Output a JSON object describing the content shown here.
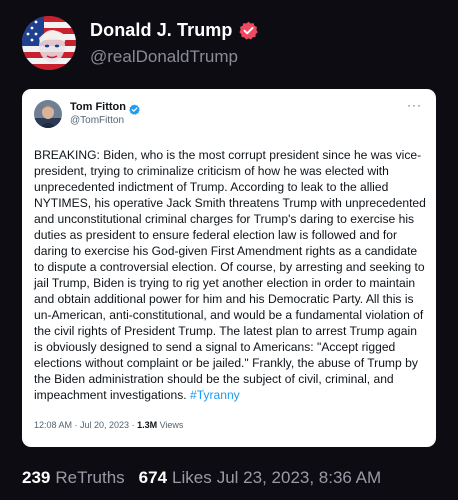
{
  "post": {
    "author_name": "Donald J. Trump",
    "author_handle": "@realDonaldTrump",
    "verified_badge_icon": "verified-check-icon",
    "verified_color": "#ee4b63"
  },
  "embedded_tweet": {
    "author_name": "Tom Fitton",
    "author_handle": "@TomFitton",
    "more_icon": "more-options-icon",
    "verified_color": "#1d9bf0",
    "body": "BREAKING: Biden, who is the most corrupt president since he was vice-president, trying to criminalize criticism of how he was elected with unprecedented indictment of Trump. According to leak to the allied NYTIMES, his operative Jack Smith threatens Trump with unprecedented and unconstitutional criminal charges for Trump's daring to exercise his duties as president to ensure federal election law is followed and  for daring to exercise his God-given First Amendment rights as a candidate to dispute a controversial election.  Of course, by arresting and seeking to jail Trump, Biden is trying to rig yet another election in order to maintain and obtain additional power for him and his Democratic Party. All this is un-American, anti-constitutional, and would be a fundamental violation of the civil rights of President Trump. The latest plan to arrest Trump again is obviously designed to send a signal to Americans: \"Accept rigged elections without complaint or be jailed.\" Frankly, the abuse of Trump by the Biden administration should be the subject of civil, criminal, and impeachment investigations.",
    "hashtag": "#Tyranny",
    "timestamp": "12:08 AM · Jul 20, 2023 · ",
    "views_count": "1.3M",
    "views_label": " Views"
  },
  "stats": {
    "retruths_count": "239",
    "retruths_label": "ReTruths",
    "likes_count": "674",
    "likes_label": "Likes",
    "date": "Jul 23, 2023, 8:36 AM"
  }
}
